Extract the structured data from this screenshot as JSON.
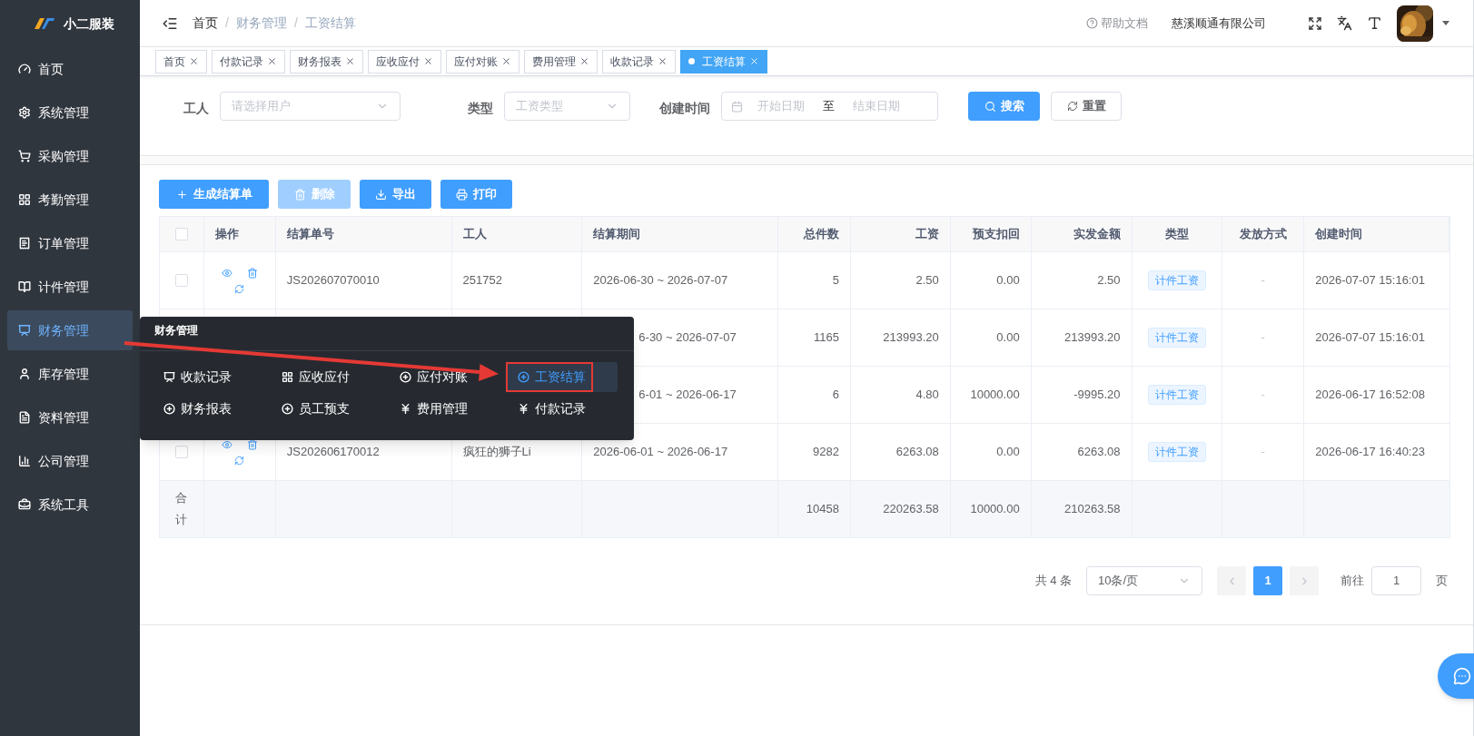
{
  "app": {
    "name": "小二服装"
  },
  "sidebar": {
    "items": [
      {
        "label": "首页",
        "selected": false
      },
      {
        "label": "系统管理",
        "selected": false
      },
      {
        "label": "采购管理",
        "selected": false
      },
      {
        "label": "考勤管理",
        "selected": false
      },
      {
        "label": "订单管理",
        "selected": false
      },
      {
        "label": "计件管理",
        "selected": false
      },
      {
        "label": "财务管理",
        "selected": true
      },
      {
        "label": "库存管理",
        "selected": false
      },
      {
        "label": "资料管理",
        "selected": false
      },
      {
        "label": "公司管理",
        "selected": false
      },
      {
        "label": "系统工具",
        "selected": false
      }
    ]
  },
  "breadcrumb": [
    "首页",
    "财务管理",
    "工资结算"
  ],
  "breadcrumb_separator": "/",
  "header": {
    "help": "帮助文档",
    "company": "慈溪顺通有限公司"
  },
  "tabs": [
    {
      "label": "首页",
      "selected": false
    },
    {
      "label": "付款记录",
      "selected": false
    },
    {
      "label": "财务报表",
      "selected": false
    },
    {
      "label": "应收应付",
      "selected": false
    },
    {
      "label": "应付对账",
      "selected": false
    },
    {
      "label": "费用管理",
      "selected": false
    },
    {
      "label": "收款记录",
      "selected": false
    },
    {
      "label": "工资结算",
      "selected": true
    }
  ],
  "filters": {
    "worker": {
      "label": "工人",
      "placeholder": "请选择用户"
    },
    "type": {
      "label": "类型",
      "placeholder": "工资类型"
    },
    "created": {
      "label": "创建时间",
      "start_placeholder": "开始日期",
      "separator": "至",
      "end_placeholder": "结束日期"
    },
    "search": "搜索",
    "reset": "重置"
  },
  "toolbar": [
    {
      "label": "生成结算单",
      "disabled": false
    },
    {
      "label": "删除",
      "disabled": true
    },
    {
      "label": "导出",
      "disabled": false
    },
    {
      "label": "打印",
      "disabled": false
    }
  ],
  "table": {
    "header_checkbox": {
      "checked": false
    },
    "columns": [
      "操作",
      "结算单号",
      "工人",
      "结算期间",
      "总件数",
      "工资",
      "预支扣回",
      "实发金额",
      "类型",
      "发放方式",
      "创建时间"
    ],
    "rows": [
      {
        "checked": false,
        "number": "JS202607070010",
        "worker": "251752",
        "period": "2026-06-30 ~ 2026-07-07",
        "total": "5",
        "wage": "2.50",
        "advance": "0.00",
        "actual": "2.50",
        "type": "计件工资",
        "method": "-",
        "created": "2026-07-07 15:16:01"
      },
      {
        "period": "6-30 ~ 2026-07-07",
        "total": "1165",
        "wage": "213993.20",
        "advance": "0.00",
        "actual": "213993.20",
        "type": "计件工资",
        "method": "-",
        "created": "2026-07-07 15:16:01"
      },
      {
        "period": "6-01 ~ 2026-06-17",
        "total": "6",
        "wage": "4.80",
        "advance": "10000.00",
        "actual": "-9995.20",
        "type": "计件工资",
        "method": "-",
        "created": "2026-06-17 16:52:08"
      },
      {
        "checked": false,
        "number": "JS202606170012",
        "worker": "疯狂的狮子Li",
        "period": "2026-06-01 ~ 2026-06-17",
        "total": "9282",
        "wage": "6263.08",
        "advance": "0.00",
        "actual": "6263.08",
        "type": "计件工资",
        "method": "-",
        "created": "2026-06-17 16:40:23"
      }
    ],
    "totals": {
      "label": "合计",
      "total": "10458",
      "wage": "220263.58",
      "advance": "10000.00",
      "actual": "210263.58"
    }
  },
  "pagination": {
    "total": "共 4 条",
    "page_size": "10条/页",
    "pages": [
      {
        "label": "1",
        "selected": true
      }
    ],
    "goto_label": "前往",
    "goto_value": "1",
    "page_suffix": "页"
  },
  "popup": {
    "title": "财务管理",
    "items": [
      {
        "label": "收款记录",
        "selected": false
      },
      {
        "label": "应收应付",
        "selected": false
      },
      {
        "label": "应付对账",
        "selected": false
      },
      {
        "label": "工资结算",
        "selected": true
      },
      {
        "label": "财务报表",
        "selected": false
      },
      {
        "label": "员工预支",
        "selected": false
      },
      {
        "label": "费用管理",
        "selected": false
      },
      {
        "label": "付款记录",
        "selected": false
      }
    ]
  },
  "annotations": {
    "arrow": true,
    "highlight_frame": true
  }
}
